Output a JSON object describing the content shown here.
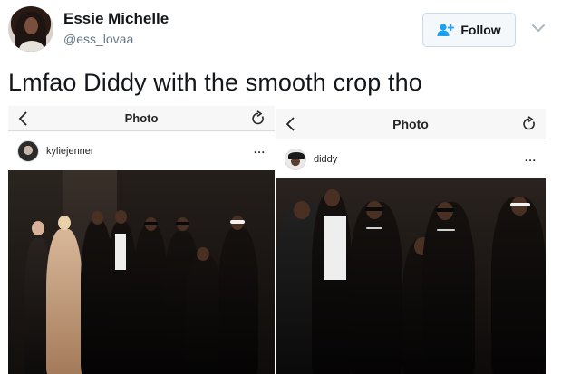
{
  "tweet": {
    "display_name": "Essie Michelle",
    "handle": "@ess_lovaa",
    "follow_label": "Follow",
    "text": "Lmfao Diddy with the smooth crop tho"
  },
  "left_screenshot": {
    "title": "Photo",
    "username": "kyliejenner",
    "more": "..."
  },
  "right_screenshot": {
    "title": "Photo",
    "username": "diddy",
    "more": "..."
  },
  "colors": {
    "text": "#14171a",
    "secondary_text": "#657786",
    "follow_button_bg": "#f5f8fa",
    "follow_icon": "#1da1f2"
  },
  "icons": [
    "follow-add-user-icon",
    "chevron-down-icon",
    "back-arrow-icon",
    "refresh-icon",
    "more-icon"
  ]
}
